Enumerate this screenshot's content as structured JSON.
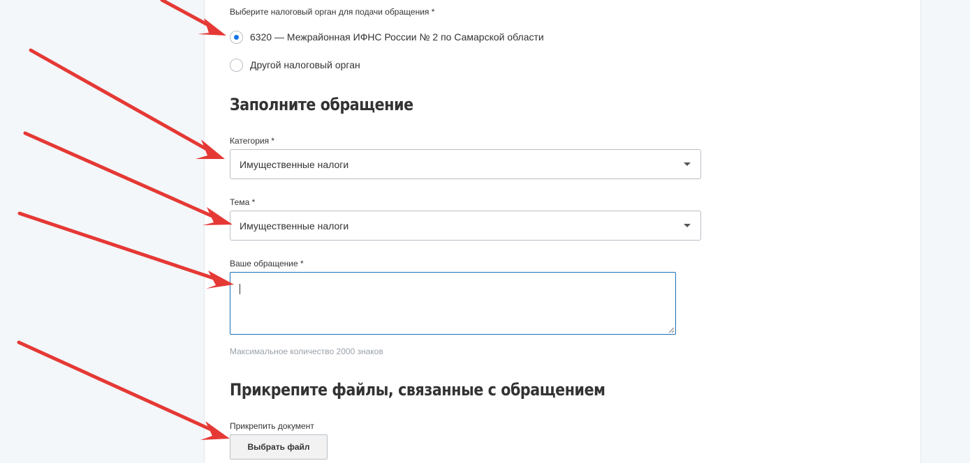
{
  "tax_office": {
    "label": "Выберите налоговый орган для подачи обращения *",
    "options": [
      {
        "label": "6320 — Межрайонная ИФНС России № 2 по Самарской области",
        "checked": true
      },
      {
        "label": "Другой налоговый орган",
        "checked": false
      }
    ]
  },
  "fill_section": {
    "heading": "Заполните обращение",
    "category": {
      "label": "Категория *",
      "value": "Имущественные налоги"
    },
    "topic": {
      "label": "Тема *",
      "value": "Имущественные налоги"
    },
    "message": {
      "label": "Ваше обращение *",
      "value": "",
      "hint": "Максимальное количество 2000 знаков"
    }
  },
  "attach_section": {
    "heading": "Прикрепите файлы, связанные с обращением",
    "attach_label": "Прикрепить документ",
    "button_label": "Выбрать файл"
  },
  "colors": {
    "accent": "#1473e6",
    "annotation_arrow": "#e53935",
    "page_background": "#f3f7fa"
  },
  "icons": {
    "dropdown": "chevron-down-icon",
    "annotation": "arrow-icon"
  }
}
